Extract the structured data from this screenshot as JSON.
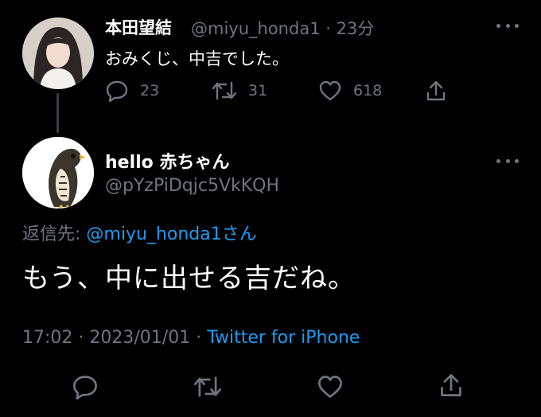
{
  "parent_tweet": {
    "display_name": "本田望結",
    "handle": "@miyu_honda1",
    "time": "23分",
    "text": "おみくじ、中吉でした。",
    "reply_count": "23",
    "retweet_count": "31",
    "like_count": "618",
    "icons": {
      "reply": "reply-icon",
      "retweet": "retweet-icon",
      "like": "heart-icon",
      "share": "share-icon",
      "more": "more-icon"
    }
  },
  "main_tweet": {
    "display_name": "hello 赤ちゃん",
    "handle": "@pYzPiDqjc5VkKQH",
    "reply_to_label": "返信先:",
    "reply_to_user": "@miyu_honda1",
    "reply_to_suffix": "さん",
    "text": "もう、中に出せる吉だね。",
    "time": "17:02",
    "date": "2023/01/01",
    "client": "Twitter for iPhone"
  },
  "colors": {
    "background": "#000000",
    "text": "#e7e9ea",
    "muted": "#6e767d",
    "accent": "#1d9bf0"
  }
}
